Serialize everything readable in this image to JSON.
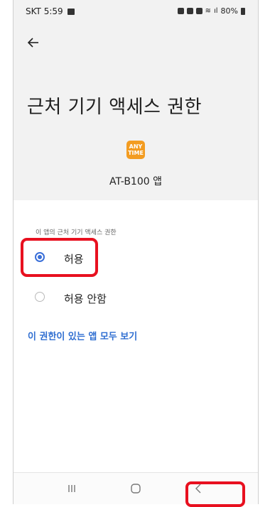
{
  "status_bar": {
    "carrier_time": "SKT 5:59",
    "battery": "80%"
  },
  "header": {
    "title": "근처 기기 액세스 권한",
    "app_logo_top": "ANY",
    "app_logo_bottom": "TIME",
    "app_name": "AT-B100 앱"
  },
  "permission": {
    "section_label": "이 앱의 근처 기기 액세스 권한",
    "options": [
      {
        "label": "허용",
        "selected": true
      },
      {
        "label": "허용 안함",
        "selected": false
      }
    ],
    "link": "이 권한이 있는 앱 모두 보기"
  },
  "colors": {
    "accent": "#3a6fd8",
    "link": "#2f6ed1",
    "highlight": "#e8101f",
    "header_bg": "#f2f2f2",
    "logo": "#f39c21"
  },
  "icons": {
    "back": "arrow-left-icon",
    "nav_recents": "recents-icon",
    "nav_home": "home-icon",
    "nav_back": "chevron-left-icon"
  }
}
